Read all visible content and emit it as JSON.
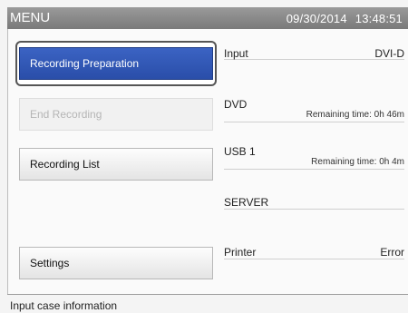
{
  "header": {
    "title": "MENU",
    "date": "09/30/2014",
    "time": "13:48:51"
  },
  "buttons": {
    "recording_preparation": "Recording Preparation",
    "end_recording": "End Recording",
    "recording_list": "Recording List",
    "settings": "Settings"
  },
  "info": {
    "input": {
      "label": "Input",
      "value": "DVI-D"
    },
    "dvd": {
      "label": "DVD",
      "remaining": "Remaining time: 0h 46m"
    },
    "usb1": {
      "label": "USB 1",
      "remaining": "Remaining time: 0h 4m"
    },
    "server": {
      "label": "SERVER"
    },
    "printer": {
      "label": "Printer",
      "value": "Error"
    }
  },
  "status": {
    "message": "Input case information"
  },
  "colors": {
    "primary_button": "#2f56b3",
    "title_bar": "#8a8a8a"
  }
}
